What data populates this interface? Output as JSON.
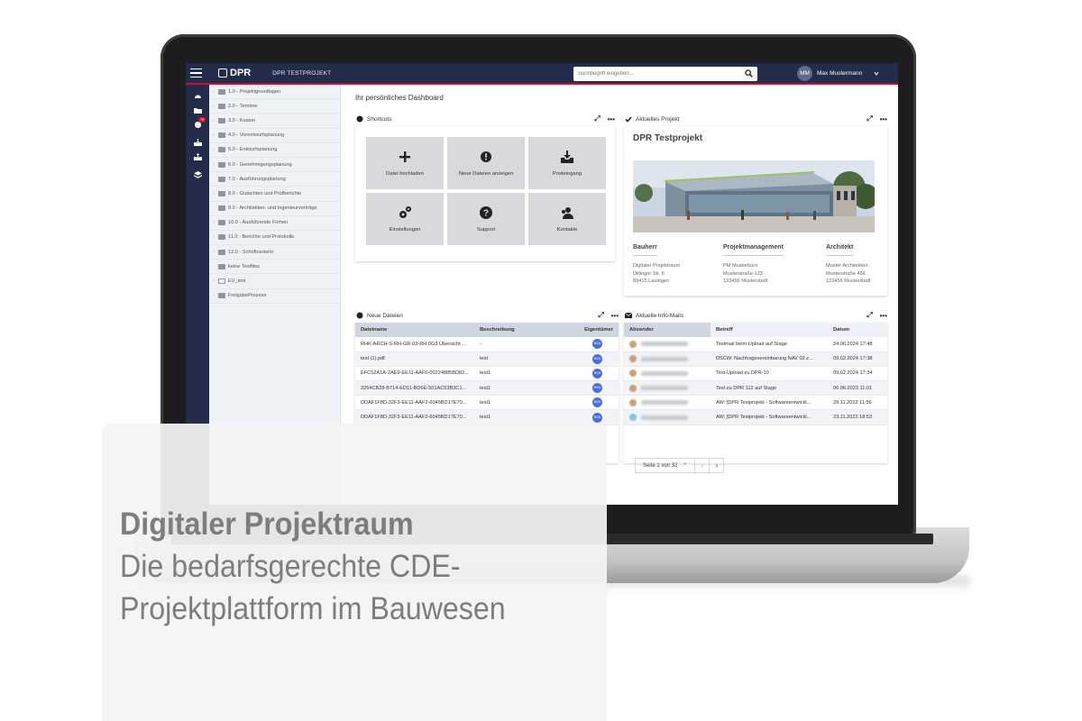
{
  "topbar": {
    "logo": "DPR",
    "logo_sub": "Digitaler Projektraum",
    "project": "DPR TESTPROJEKT",
    "search_placeholder": "Suchbegriff eingeben...",
    "user_initials": "MM",
    "user_name": "Max Mustermann"
  },
  "rail": {
    "notification_count": "75"
  },
  "tree": [
    {
      "label": "1.0 - Projektgrundlagen"
    },
    {
      "label": "2.0 - Termine"
    },
    {
      "label": "3.0 - Kosten"
    },
    {
      "label": "4.0 - Vorentwurfsplanung"
    },
    {
      "label": "5.0 - Entwurfsplanung"
    },
    {
      "label": "6.0 - Genehmigungsplanung"
    },
    {
      "label": "7.0 - Ausführungsplanung"
    },
    {
      "label": "8.0 - Gutachten und Prüfberichte"
    },
    {
      "label": "9.0 - Architekten- und Ingenieurverträge"
    },
    {
      "label": "10.0 - Ausführende Firmen"
    },
    {
      "label": "11.0 - Berichte und Protokolle"
    },
    {
      "label": "12.0 - Schriftverkehr"
    },
    {
      "label": "keine Testfiles"
    },
    {
      "label": "EV_test"
    },
    {
      "label": "FreigabeProzess"
    }
  ],
  "dashboard": {
    "title": "Ihr persönliches Dashboard"
  },
  "shortcuts": {
    "title": "Shortcuts",
    "tiles": [
      {
        "label": "Datei hochladen",
        "icon": "plus-icon"
      },
      {
        "label": "Neue Dateien anzeigen",
        "icon": "badge-icon"
      },
      {
        "label": "Posteingang",
        "icon": "inbox-icon"
      },
      {
        "label": "Einstellungen",
        "icon": "gears-icon"
      },
      {
        "label": "Support",
        "icon": "help-icon"
      },
      {
        "label": "Kontakte",
        "icon": "contacts-icon"
      }
    ]
  },
  "project": {
    "card_title": "Aktuelles Projekt",
    "name": "DPR Testprojekt",
    "bauherr": {
      "heading": "Bauherr",
      "line1": "Digitaler Projektraum",
      "line2": "Dillinger Str. 6",
      "line3": "89415 Lauingen"
    },
    "pm": {
      "heading": "Projektmanagement",
      "line1": "PM Musterbüro",
      "line2": "Musterstraße 123",
      "line3": "123456 Musterstadt"
    },
    "architekt": {
      "heading": "Architekt",
      "line1": "Muster Architekten",
      "line2": "Musterstraße 456",
      "line3": "123456 Musterstadt"
    }
  },
  "new_files": {
    "title": "Neue Dateien",
    "columns": [
      "Dateiname",
      "Beschreibung",
      "Eigentümer"
    ],
    "rows": [
      {
        "name": "RHK-ARCH-S-RH-GR-03-RH 0G3 Übersicht ...",
        "desc": "-",
        "owner": "BOA"
      },
      {
        "name": "test (1).pdf",
        "desc": "test",
        "owner": "BOA"
      },
      {
        "name": "EFC52A1A-2AE9-EE11-AAF0-00224885BD82...",
        "desc": "test1",
        "owner": "BOA"
      },
      {
        "name": "3254CB28-B714-ED11-BD6E-501AC53B3C1...",
        "desc": "test1",
        "owner": "BOA"
      },
      {
        "name": "DDAF1F8D-32F3-EE11-AAF2-6045BD17E70...",
        "desc": "test1",
        "owner": "BOA"
      },
      {
        "name": "DDAF1F8D-32F3-EE11-AAF2-6045BD17E70...",
        "desc": "test1",
        "owner": "BOA"
      }
    ]
  },
  "mails": {
    "title": "Aktuelle Info-Mails",
    "columns": [
      "Absender",
      "Betreff",
      "Datum"
    ],
    "rows": [
      {
        "subject": "Testmail beim Upload auf Stage",
        "date": "24.06.2024 17:48"
      },
      {
        "subject": "DSCW: Nachtragsvereinbarung NAV 02 z...",
        "date": "09.02.2024 17:38"
      },
      {
        "subject": "Test-Upload zu DPR-10",
        "date": "09.02.2024 17:34"
      },
      {
        "subject": "Test zu DPR 112 auf Stage",
        "date": "06.06.2023 11:01"
      },
      {
        "subject": "AW: [DPR Testprojekt - Softwareentwickl...",
        "date": "29.11.2022 11:56"
      },
      {
        "subject": "AW: [DPR Testprojekt - Softwareentwickl...",
        "date": "23.11.2022 18:53"
      }
    ],
    "pager": "Seite 1 von 32"
  },
  "promo": {
    "title": "Digitaler Projektraum",
    "line1": "Die bedarfsgerechte CDE-",
    "line2": "Projektplattform im Bauwesen"
  },
  "colors": {
    "navy": "#232d4b",
    "accent_red": "#c8102e",
    "owner_badge": "#4b6fd6",
    "tile_bg": "#d7d9dd"
  }
}
